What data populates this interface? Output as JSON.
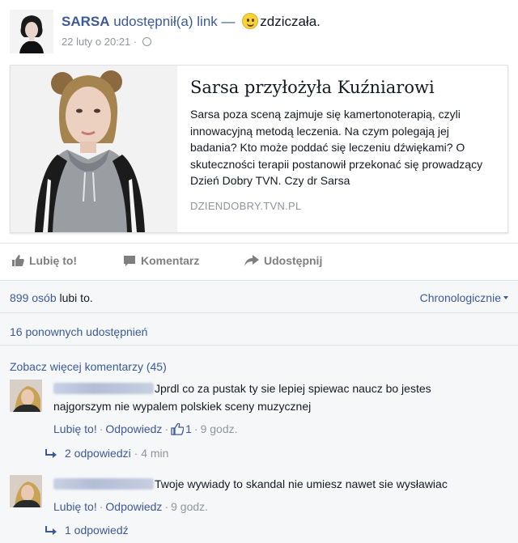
{
  "post": {
    "page_name": "SARSA",
    "verb": "udostępnił(a)",
    "link_word": "link",
    "dash": "—",
    "feeling": "zdziczała.",
    "timestamp": "22 luty o 20:21",
    "globe_icon": "globe-icon"
  },
  "link_card": {
    "title": "Sarsa przyłożyła Kuźniarowi",
    "description": "Sarsa poza sceną zajmuje się kamertonoterapią, czyli innowacyjną metodą leczenia. Na czym polegają jej badania? Kto może poddać się leczeniu dźwiękami? O skuteczności terapii postanowił przekonać się prowadzący Dzień Dobry TVN. Czy dr Sarsa",
    "domain": "DZIENDOBRY.TVN.PL"
  },
  "actions": {
    "like": "Lubię to!",
    "comment": "Komentarz",
    "share": "Udostępnij"
  },
  "feedback": {
    "likes_count": "899 osób",
    "likes_text": "lubi to.",
    "sort": "Chronologicznie",
    "shares": "16 ponownych udostępnień",
    "more_comments": "Zobacz więcej komentarzy (45)"
  },
  "comments": [
    {
      "text": "Jprdl co za pustak ty sie lepiej spiewac naucz bo jestes najgorszym nie wypalem polskiek sceny muzycznej",
      "like_label": "Lubię to!",
      "reply_label": "Odpowiedz",
      "like_count": "1",
      "time": "9 godz.",
      "replies_label": "2 odpowiedzi",
      "replies_time": "4 min"
    },
    {
      "text": "Twoje wywiady to skandal nie umiesz nawet sie wysławiac",
      "like_label": "Lubię to!",
      "reply_label": "Odpowiedz",
      "time": "9 godz.",
      "replies_label": "1 odpowiedź"
    }
  ],
  "colors": {
    "link_blue": "#3b5998",
    "meta_gray": "#90949c",
    "feedback_bg": "#f6f7f9"
  }
}
